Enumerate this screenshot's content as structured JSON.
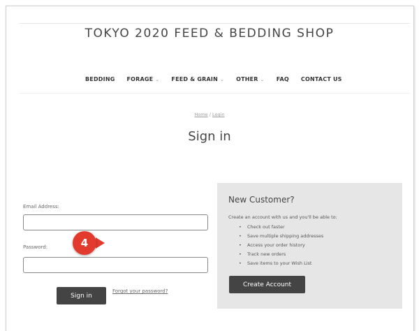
{
  "header": {
    "site_title": "TOKYO 2020 FEED & BEDDING SHOP"
  },
  "nav": {
    "items": [
      {
        "label": "BEDDING",
        "has_dropdown": false
      },
      {
        "label": "FORAGE",
        "has_dropdown": true
      },
      {
        "label": "FEED & GRAIN",
        "has_dropdown": true
      },
      {
        "label": "OTHER",
        "has_dropdown": true
      },
      {
        "label": "FAQ",
        "has_dropdown": false
      },
      {
        "label": "CONTACT US",
        "has_dropdown": false
      }
    ]
  },
  "breadcrumb": {
    "home": "Home",
    "separator": "/",
    "current": "Login"
  },
  "page": {
    "heading": "Sign in"
  },
  "login_form": {
    "email_label": "Email Address:",
    "email_value": "",
    "password_label": "Password:",
    "password_value": "",
    "submit_label": "Sign in",
    "forgot_label": "Forgot your password?"
  },
  "annotation": {
    "step_number": "4",
    "color": "#e23b2e"
  },
  "new_customer": {
    "title": "New Customer?",
    "intro": "Create an account with us and you'll be able to:",
    "benefits": [
      "Check out faster",
      "Save multiple shipping addresses",
      "Access your order history",
      "Track new orders",
      "Save items to your Wish List"
    ],
    "button_label": "Create Account"
  },
  "colors": {
    "button_dark": "#444444",
    "panel_bg": "#e6e6e6"
  }
}
